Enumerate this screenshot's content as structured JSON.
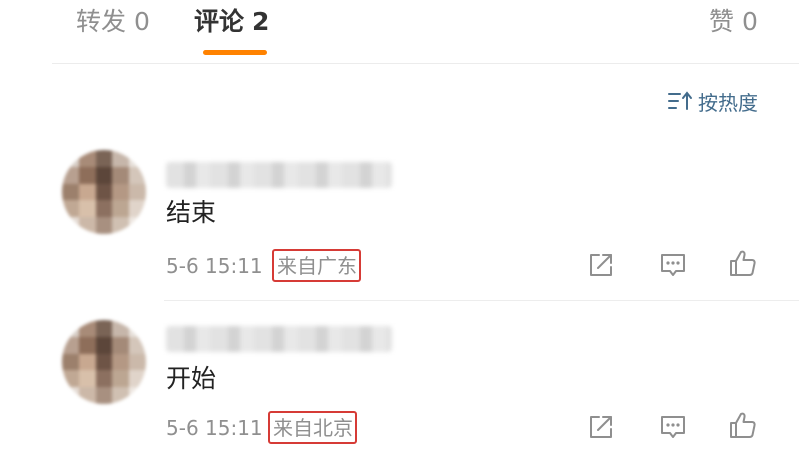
{
  "tabs": {
    "repost": {
      "label": "转发",
      "count": "0"
    },
    "comment": {
      "label": "评论",
      "count": "2"
    },
    "like": {
      "label": "赞",
      "count": "0"
    }
  },
  "accent_color": "#ff8200",
  "sort": {
    "label": "按热度",
    "icon": "sort-icon"
  },
  "comments": [
    {
      "text": "结束",
      "time": "5-6 15:11",
      "location": "来自广东"
    },
    {
      "text": "开始",
      "time": "5-6 15:11",
      "location": "来自北京"
    }
  ],
  "actions": {
    "share_icon": "share-icon",
    "reply_icon": "comment-icon",
    "like_icon": "thumbs-up-icon"
  },
  "highlight_color": "#d63b36"
}
